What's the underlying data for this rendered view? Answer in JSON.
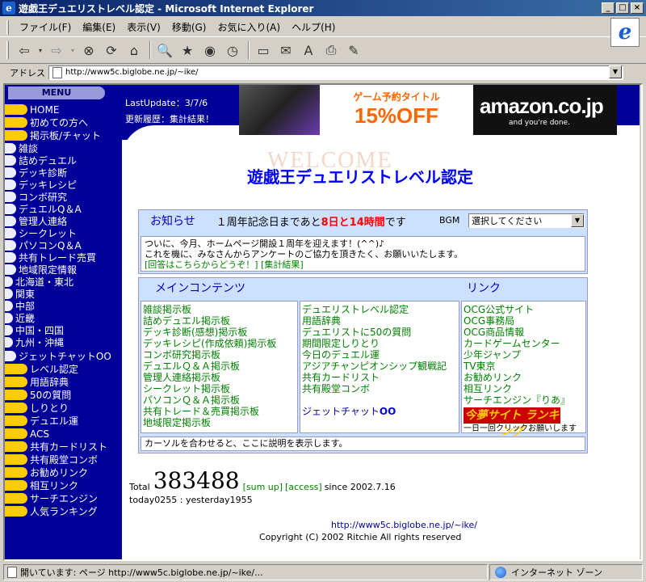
{
  "window": {
    "title": "遊戯王デュエリストレベル認定 - Microsoft Internet Explorer",
    "buttons": [
      "_",
      "□",
      "×"
    ]
  },
  "menubar": [
    "ファイル(F)",
    "編集(E)",
    "表示(V)",
    "移動(G)",
    "お気に入り(A)",
    "ヘルプ(H)"
  ],
  "address": {
    "label": "アドレス",
    "url": "http://www5c.biglobe.ne.jp/~ike/"
  },
  "sidebar": {
    "header": "MENU",
    "items": [
      "HOME",
      "初めての方へ",
      "掲示板/チャット",
      "雑談",
      "詰めデュエル",
      "デッキ診断",
      "デッキレシピ",
      "コンボ研究",
      "デュエルQ＆A",
      "管理人連絡",
      "シークレット",
      "パソコンQ＆A",
      "共有トレード売買",
      "地域限定情報",
      "北海道・東北",
      "関東",
      "中部",
      "近畿",
      "中国・四国",
      "九州・沖縄",
      "ジェットチャットOO",
      "レベル認定",
      "用語辞典",
      "50の質問",
      "しりとり",
      "デュエル運",
      "ACS",
      "共有カードリスト",
      "共有殿堂コンボ",
      "お勧めリンク",
      "相互リンク",
      "サーチエンジン",
      "人気ランキング"
    ]
  },
  "header": {
    "last_update": "LastUpdate：3/7/6",
    "history": "更新履歴：集計結果！",
    "banner": {
      "line1": "ゲーム予約タイトル",
      "line2": "15%OFF",
      "brand": "amazon.co.jp",
      "tagline": "and you're done."
    }
  },
  "watermark": "WELCOME",
  "site_title": "遊戯王デュエリストレベル認定",
  "news": {
    "title": "お知らせ",
    "countdown_prefix": "１周年記念日まであと",
    "countdown_value": "8日と14時間",
    "countdown_suffix": "です",
    "bgm_label": "BGM",
    "bgm_select": "選択してください",
    "body_line1": "ついに、今月、ホームページ開設１周年を迎えます！(^^)♪",
    "body_line2": "これを機に、みなさんからアンケートのご協力を頂きたく、お願いいたします。",
    "body_links": "[回答はこちらからどうぞ！] [集計結果]"
  },
  "main": {
    "heading_contents": "メインコンテンツ",
    "heading_links": "リンク",
    "col1": [
      "雑談掲示板",
      "詰めデュエル掲示板",
      "デッキ診断(感想)掲示板",
      "デッキレシピ(作成依頼)掲示板",
      "コンボ研究掲示板",
      "デュエルＱ＆Ａ掲示板",
      "管理人連絡掲示板",
      "シークレット掲示板",
      "パソコンＱ＆Ａ掲示板",
      "共有トレード＆売買掲示板",
      "地域限定掲示板"
    ],
    "col2": [
      "デュエリストレベル認定",
      "用語辞典",
      "デュエリストに50の質問",
      "期間限定しりとり",
      "今日のデュエル運",
      "アジアチャンピオンシップ観戦記",
      "共有カードリスト",
      "共有殿堂コンボ"
    ],
    "col2_chat_label": "ジェットチャット",
    "col2_chat_suffix": "OO",
    "col3": [
      "OCG公式サイト",
      "OCG事務局",
      "OCG商品情報",
      "カードゲームセンター",
      "少年ジャンプ",
      "TV東京",
      "お勧めリンク",
      "相互リンク",
      "サーチエンジン『りあ』"
    ],
    "ranking_badge": "今夢サイト ランキング",
    "ranking_caption": "一日一回クリックお願いします",
    "description": "カーソルを合わせると、ここに説明を表示します。"
  },
  "counter": {
    "total_label": "Total",
    "total_value": "383488",
    "sum_up": "[sum up]",
    "access": "[access]",
    "since": "since 2002.7.16",
    "today": "today0255 : yesterday1955"
  },
  "footer": {
    "url": "http://www5c.biglobe.ne.jp/~ike/",
    "copyright": "Copyright (C) 2002 Ritchie All rights reserved"
  },
  "status": {
    "message": "開いています: ページ http://www5c.biglobe.ne.jp/~ike/...",
    "zone": "インターネット ゾーン"
  },
  "colors": {
    "sidebar_bg": "#000099",
    "bullet_yellow": "#ffcc00",
    "title_blue": "#0000ff",
    "link_green": "#008000",
    "table_bg": "#cce0ff"
  }
}
